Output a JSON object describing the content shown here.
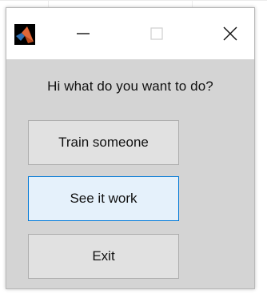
{
  "window": {
    "title": "",
    "controls": {
      "minimize": "minimize-icon",
      "maximize": "maximize-icon",
      "close": "close-icon"
    },
    "app_icon": "matlab-icon"
  },
  "dialog": {
    "prompt": "Hi what do you want to do?",
    "buttons": [
      {
        "label": "Train someone",
        "focused": false
      },
      {
        "label": "See it work",
        "focused": true
      },
      {
        "label": "Exit",
        "focused": false
      }
    ]
  },
  "colors": {
    "window_bg": "#d4d4d4",
    "button_bg": "#e1e1e1",
    "button_border": "#adadad",
    "focused_bg": "#e5f1fb",
    "focused_border": "#0078d7",
    "matlab_orange": "#e16737",
    "matlab_blue": "#2f6fb3"
  }
}
